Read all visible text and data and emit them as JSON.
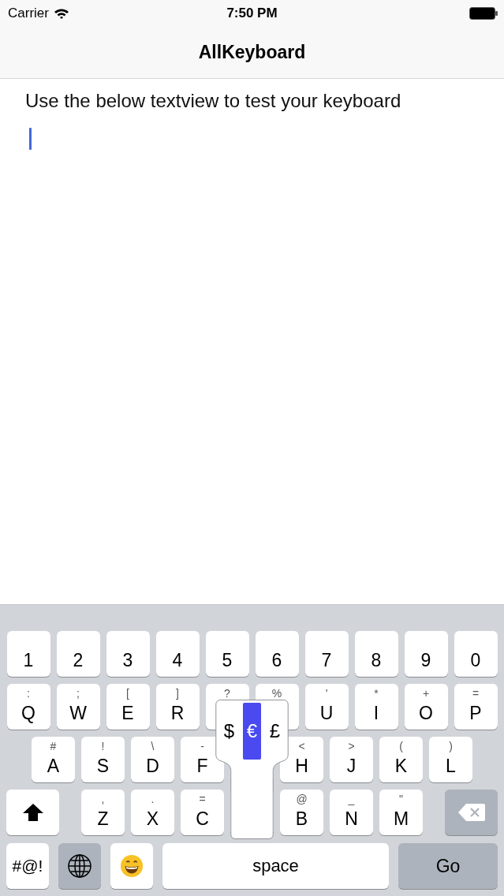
{
  "status_bar": {
    "carrier": "Carrier",
    "time": "7:50 PM"
  },
  "nav_bar": {
    "title": "AllKeyboard"
  },
  "instruction": "Use the below textview to test your keyboard",
  "text_view": {
    "focused": true
  },
  "keyboard": {
    "rows": [
      [
        {
          "kind": "char",
          "label": "1"
        },
        {
          "kind": "char",
          "label": "2"
        },
        {
          "kind": "char",
          "label": "3"
        },
        {
          "kind": "char",
          "label": "4"
        },
        {
          "kind": "char",
          "label": "5"
        },
        {
          "kind": "char",
          "label": "6"
        },
        {
          "kind": "char",
          "label": "7"
        },
        {
          "kind": "char",
          "label": "8"
        },
        {
          "kind": "char",
          "label": "9"
        },
        {
          "kind": "char",
          "label": "0"
        }
      ],
      [
        {
          "kind": "char",
          "hint": ":",
          "label": "Q"
        },
        {
          "kind": "char",
          "hint": ";",
          "label": "W"
        },
        {
          "kind": "char",
          "hint": "[",
          "label": "E"
        },
        {
          "kind": "char",
          "hint": "]",
          "label": "R"
        },
        {
          "kind": "char",
          "hint": "?"
        },
        {
          "kind": "char",
          "hint": "%"
        },
        {
          "kind": "char",
          "hint": "'",
          "label": "U"
        },
        {
          "kind": "char",
          "hint": "*",
          "label": "I"
        },
        {
          "kind": "char",
          "hint": "+",
          "label": "O"
        },
        {
          "kind": "char",
          "hint": "=",
          "label": "P"
        }
      ],
      [
        {
          "kind": "char",
          "hint": "#",
          "label": "A"
        },
        {
          "kind": "char",
          "hint": "!",
          "label": "S"
        },
        {
          "kind": "char",
          "hint": "\\",
          "label": "D"
        },
        {
          "kind": "char",
          "hint": "-",
          "label": "F"
        },
        {
          "kind": "char"
        },
        {
          "kind": "char",
          "hint": "<",
          "label": "H"
        },
        {
          "kind": "char",
          "hint": ">",
          "label": "J"
        },
        {
          "kind": "char",
          "hint": "(",
          "label": "K"
        },
        {
          "kind": "char",
          "hint": ")",
          "label": "L"
        }
      ],
      [
        {
          "kind": "shift"
        },
        {
          "kind": "char",
          "hint": ",",
          "label": "Z"
        },
        {
          "kind": "char",
          "hint": ".",
          "label": "X"
        },
        {
          "kind": "char",
          "hint": "=",
          "label": "C"
        },
        {
          "kind": "char"
        },
        {
          "kind": "char",
          "hint": "@",
          "label": "B"
        },
        {
          "kind": "char",
          "hint": "_",
          "label": "N"
        },
        {
          "kind": "char",
          "hint": "\"",
          "label": "M"
        },
        {
          "kind": "backspace"
        }
      ],
      [
        {
          "kind": "symbols",
          "label": "#@!"
        },
        {
          "kind": "globe"
        },
        {
          "kind": "emoji"
        },
        {
          "kind": "space",
          "label": "space"
        },
        {
          "kind": "return",
          "label": "Go"
        }
      ]
    ],
    "popup": {
      "options": [
        {
          "label": "$",
          "selected": false
        },
        {
          "label": "€",
          "selected": true
        },
        {
          "label": "£",
          "selected": false
        }
      ]
    }
  }
}
